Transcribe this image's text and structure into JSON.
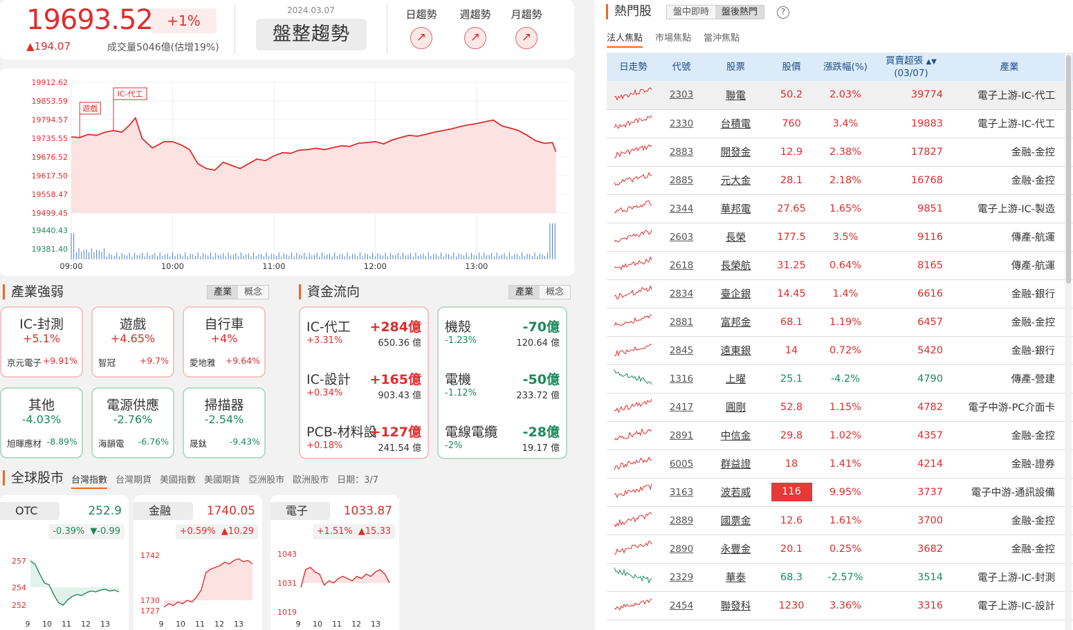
{
  "index": {
    "value": "19693.52",
    "pct": "+1%",
    "change": "▲194.07",
    "volume": "成交量5046億(估增19%)",
    "date": "2024.03.07",
    "state": "盤整趨勢"
  },
  "trends": [
    {
      "label": "日趨勢",
      "icon": "trend-up-icon"
    },
    {
      "label": "週趨勢",
      "icon": "trend-up-icon"
    },
    {
      "label": "月趨勢",
      "icon": "trend-up-icon"
    }
  ],
  "chart_data": {
    "type": "area",
    "title": "",
    "ytick_labels": [
      "19912.62",
      "19853.59",
      "19794.57",
      "19735.55",
      "19676.52",
      "19617.50",
      "19558.47",
      "19499.45"
    ],
    "volume_tick_labels": [
      "19440.43",
      "19381.40"
    ],
    "xtick_labels": [
      "09:00",
      "10:00",
      "11:00",
      "12:00",
      "13:00"
    ],
    "ylim": [
      19499.45,
      19912.62
    ],
    "xlim": [
      "09:00",
      "13:30"
    ],
    "x_minutes_from_open": [
      0,
      5,
      10,
      15,
      20,
      25,
      30,
      35,
      38,
      42,
      48,
      55,
      60,
      65,
      70,
      75,
      80,
      85,
      90,
      95,
      100,
      105,
      110,
      115,
      120,
      125,
      130,
      135,
      140,
      145,
      150,
      155,
      160,
      165,
      170,
      175,
      180,
      185,
      190,
      195,
      200,
      205,
      210,
      215,
      220,
      225,
      230,
      235,
      240,
      245,
      250,
      255,
      260,
      265,
      270,
      275,
      280,
      285,
      287
    ],
    "values": [
      19740,
      19738,
      19748,
      19745,
      19755,
      19760,
      19755,
      19780,
      19800,
      19735,
      19705,
      19725,
      19725,
      19715,
      19700,
      19655,
      19640,
      19635,
      19660,
      19650,
      19640,
      19655,
      19670,
      19665,
      19680,
      19690,
      19688,
      19698,
      19700,
      19704,
      19700,
      19706,
      19712,
      19710,
      19720,
      19722,
      19725,
      19718,
      19730,
      19738,
      19745,
      19742,
      19748,
      19755,
      19760,
      19765,
      19772,
      19778,
      19782,
      19788,
      19793,
      19775,
      19768,
      19760,
      19745,
      19728,
      19720,
      19722,
      19693
    ],
    "annotations": [
      {
        "label": "遊戲",
        "x": 5
      },
      {
        "label": "IC-代工",
        "x": 25
      }
    ],
    "color": "#e02c2c"
  },
  "industry": {
    "title": "產業強弱",
    "toggle": [
      "產業",
      "概念"
    ]
  },
  "industries": [
    {
      "name": "IC-封測",
      "pct": "+5.1%",
      "stock": "京元電子",
      "sp": "+9.91%",
      "dir": "up"
    },
    {
      "name": "遊戲",
      "pct": "+4.65%",
      "stock": "智冠",
      "sp": "+9.7%",
      "dir": "up"
    },
    {
      "name": "自行車",
      "pct": "+4%",
      "stock": "愛地雅",
      "sp": "+9.64%",
      "dir": "up"
    },
    {
      "name": "其他",
      "pct": "-4.03%",
      "stock": "旭暉應材",
      "sp": "-8.89%",
      "dir": "dn"
    },
    {
      "name": "電源供應",
      "pct": "-2.76%",
      "stock": "海韻電",
      "sp": "-6.76%",
      "dir": "dn"
    },
    {
      "name": "掃描器",
      "pct": "-2.54%",
      "stock": "晟鈦",
      "sp": "-9.43%",
      "dir": "dn"
    }
  ],
  "capital": {
    "title": "資金流向",
    "toggle": [
      "產業",
      "概念"
    ]
  },
  "inflow": [
    {
      "name": "IC-代工",
      "amt": "+284億",
      "pct": "+3.31%",
      "size": "650.36 億"
    },
    {
      "name": "IC-設計",
      "amt": "+165億",
      "pct": "+0.34%",
      "size": "903.43 億"
    },
    {
      "name": "PCB-材料設",
      "amt": "+127億",
      "pct": "+0.18%",
      "size": "241.54 億"
    }
  ],
  "outflow": [
    {
      "name": "機殼",
      "amt": "-70億",
      "pct": "-1.23%",
      "size": "120.64 億"
    },
    {
      "name": "電機",
      "amt": "-50億",
      "pct": "-1.12%",
      "size": "233.72 億"
    },
    {
      "name": "電線電纜",
      "amt": "-28億",
      "pct": "-2%",
      "size": "19.17 億"
    }
  ],
  "global": {
    "title": "全球股市",
    "tabs": [
      "台灣指數",
      "台灣期貨",
      "美國指數",
      "美國期貨",
      "亞洲股市",
      "歐洲股市"
    ],
    "date": "日期：3/7"
  },
  "minis": [
    {
      "name": "OTC",
      "value": "252.9",
      "pct": "-0.39%",
      "chg": "▼-0.99",
      "dir": "dn",
      "yticks": [
        "257",
        "254",
        "252"
      ],
      "xticks": [
        "9",
        "10",
        "11",
        "12",
        "13"
      ]
    },
    {
      "name": "金融",
      "value": "1740.05",
      "pct": "+0.59%",
      "chg": "▲10.29",
      "dir": "up",
      "yticks": [
        "1742",
        "1730",
        "1727"
      ],
      "xticks": [
        "9",
        "10",
        "11",
        "12",
        "13"
      ]
    },
    {
      "name": "電子",
      "value": "1033.87",
      "pct": "+1.51%",
      "chg": "▲15.33",
      "dir": "up",
      "yticks": [
        "1043",
        "1031",
        "1019"
      ],
      "xticks": [
        "9",
        "10",
        "11",
        "12",
        "13"
      ]
    }
  ],
  "hot": {
    "title": "熱門股",
    "toggle": [
      "盤中即時",
      "盤後熱門"
    ],
    "subtabs": [
      "法人焦點",
      "市場焦點",
      "當沖焦點"
    ],
    "headers": [
      "日走勢",
      "代號",
      "股票",
      "股價",
      "漲跌幅(%)",
      "買賣超張",
      "(03/07)",
      "產業"
    ]
  },
  "stocks": [
    {
      "code": "2303",
      "name": "聯電",
      "price": "50.2",
      "pct": "2.03%",
      "vol": "39774",
      "ind": "電子上游-IC-代工",
      "dir": "up"
    },
    {
      "code": "2330",
      "name": "台積電",
      "price": "760",
      "pct": "3.4%",
      "vol": "19883",
      "ind": "電子上游-IC-代工",
      "dir": "up"
    },
    {
      "code": "2883",
      "name": "開發金",
      "price": "12.9",
      "pct": "2.38%",
      "vol": "17827",
      "ind": "金融-金控",
      "dir": "up"
    },
    {
      "code": "2885",
      "name": "元大金",
      "price": "28.1",
      "pct": "2.18%",
      "vol": "16768",
      "ind": "金融-金控",
      "dir": "up"
    },
    {
      "code": "2344",
      "name": "華邦電",
      "price": "27.65",
      "pct": "1.65%",
      "vol": "9851",
      "ind": "電子上游-IC-製造",
      "dir": "up"
    },
    {
      "code": "2603",
      "name": "長榮",
      "price": "177.5",
      "pct": "3.5%",
      "vol": "9116",
      "ind": "傳產-航運",
      "dir": "up"
    },
    {
      "code": "2618",
      "name": "長榮航",
      "price": "31.25",
      "pct": "0.64%",
      "vol": "8165",
      "ind": "傳產-航運",
      "dir": "up"
    },
    {
      "code": "2834",
      "name": "臺企銀",
      "price": "14.45",
      "pct": "1.4%",
      "vol": "6616",
      "ind": "金融-銀行",
      "dir": "up"
    },
    {
      "code": "2881",
      "name": "富邦金",
      "price": "68.1",
      "pct": "1.19%",
      "vol": "6457",
      "ind": "金融-金控",
      "dir": "up"
    },
    {
      "code": "2845",
      "name": "遠東銀",
      "price": "14",
      "pct": "0.72%",
      "vol": "5420",
      "ind": "金融-銀行",
      "dir": "up"
    },
    {
      "code": "1316",
      "name": "上曜",
      "price": "25.1",
      "pct": "-4.2%",
      "vol": "4790",
      "ind": "傳產-營建",
      "dir": "dn"
    },
    {
      "code": "2417",
      "name": "圓剛",
      "price": "52.8",
      "pct": "1.15%",
      "vol": "4782",
      "ind": "電子中游-PC介面卡",
      "dir": "up"
    },
    {
      "code": "2891",
      "name": "中信金",
      "price": "29.8",
      "pct": "1.02%",
      "vol": "4357",
      "ind": "金融-金控",
      "dir": "up"
    },
    {
      "code": "6005",
      "name": "群益證",
      "price": "18",
      "pct": "1.41%",
      "vol": "4214",
      "ind": "金融-證券",
      "dir": "up"
    },
    {
      "code": "3163",
      "name": "波若威",
      "price": "116",
      "pct": "9.95%",
      "vol": "3737",
      "ind": "電子中游-通訊設備",
      "dir": "up",
      "limit": true
    },
    {
      "code": "2889",
      "name": "國票金",
      "price": "12.6",
      "pct": "1.61%",
      "vol": "3700",
      "ind": "金融-金控",
      "dir": "up"
    },
    {
      "code": "2890",
      "name": "永豐金",
      "price": "20.1",
      "pct": "0.25%",
      "vol": "3682",
      "ind": "金融-金控",
      "dir": "up"
    },
    {
      "code": "2329",
      "name": "華泰",
      "price": "68.3",
      "pct": "-2.57%",
      "vol": "3514",
      "ind": "電子上游-IC-封測",
      "dir": "dn"
    },
    {
      "code": "2454",
      "name": "聯發科",
      "price": "1230",
      "pct": "3.36%",
      "vol": "3316",
      "ind": "電子上游-IC-設計",
      "dir": "up"
    }
  ]
}
